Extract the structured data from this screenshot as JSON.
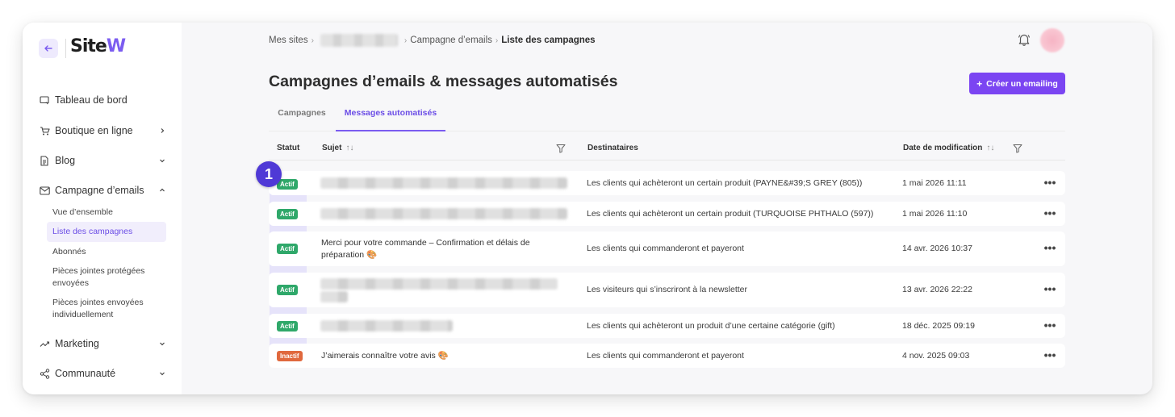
{
  "sidebar": {
    "logo": {
      "part1": "Site",
      "part2": "W"
    },
    "items": [
      {
        "label": "Tableau de bord"
      },
      {
        "label": "Boutique en ligne"
      },
      {
        "label": "Blog"
      },
      {
        "label": "Campagne d’emails"
      },
      {
        "label": "Marketing"
      },
      {
        "label": "Communauté"
      }
    ],
    "sub_items": [
      {
        "label": "Vue d’ensemble"
      },
      {
        "label": "Liste des campagnes"
      },
      {
        "label": "Abonnés"
      },
      {
        "label": "Pièces jointes protégées envoyées"
      },
      {
        "label": "Pièces jointes envoyées individuellement"
      }
    ]
  },
  "breadcrumb": {
    "first": "Mes sites",
    "third": "Campagne d’emails",
    "last": "Liste des campagnes"
  },
  "page_title": "Campagnes d’emails & messages automatisés",
  "create_button": {
    "plus": "+",
    "label": "Créer un emailing"
  },
  "tabs": [
    {
      "label": "Campagnes"
    },
    {
      "label": "Messages automatisés"
    }
  ],
  "columns": {
    "status": "Statut",
    "subject": "Sujet",
    "recipients": "Destinataires",
    "date": "Date de modification"
  },
  "step_marker": "1",
  "rows": [
    {
      "status": "Actif",
      "subject": "",
      "recipients": "Les clients qui achèteront un certain produit (PAYNE&#39;S GREY (805))",
      "date": "1 mai 2026 11:11"
    },
    {
      "status": "Actif",
      "subject": "",
      "recipients": "Les clients qui achèteront un certain produit (TURQUOISE PHTHALO (597))",
      "date": "1 mai 2026 11:10"
    },
    {
      "status": "Actif",
      "subject": "Merci pour votre commande – Confirmation et délais de préparation 🎨",
      "recipients": "Les clients qui commanderont et payeront",
      "date": "14 avr. 2026 10:37"
    },
    {
      "status": "Actif",
      "subject": "",
      "recipients": "Les visiteurs qui s’inscriront à la newsletter",
      "date": "13 avr. 2026 22:22"
    },
    {
      "status": "Actif",
      "subject": "",
      "recipients": "Les clients qui achèteront un produit d’une certaine catégorie (gift)",
      "date": "18 déc. 2025 09:19"
    },
    {
      "status": "Inactif",
      "subject": "J’aimerais connaître votre avis 🎨",
      "recipients": "Les clients qui commanderont et payeront",
      "date": "4 nov. 2025 09:03"
    }
  ],
  "more_label": "•••",
  "colors": {
    "accent": "#7b45f2",
    "active_badge": "#2fa86a",
    "inactive_badge": "#e0683d",
    "step_marker": "#4f39d6"
  }
}
